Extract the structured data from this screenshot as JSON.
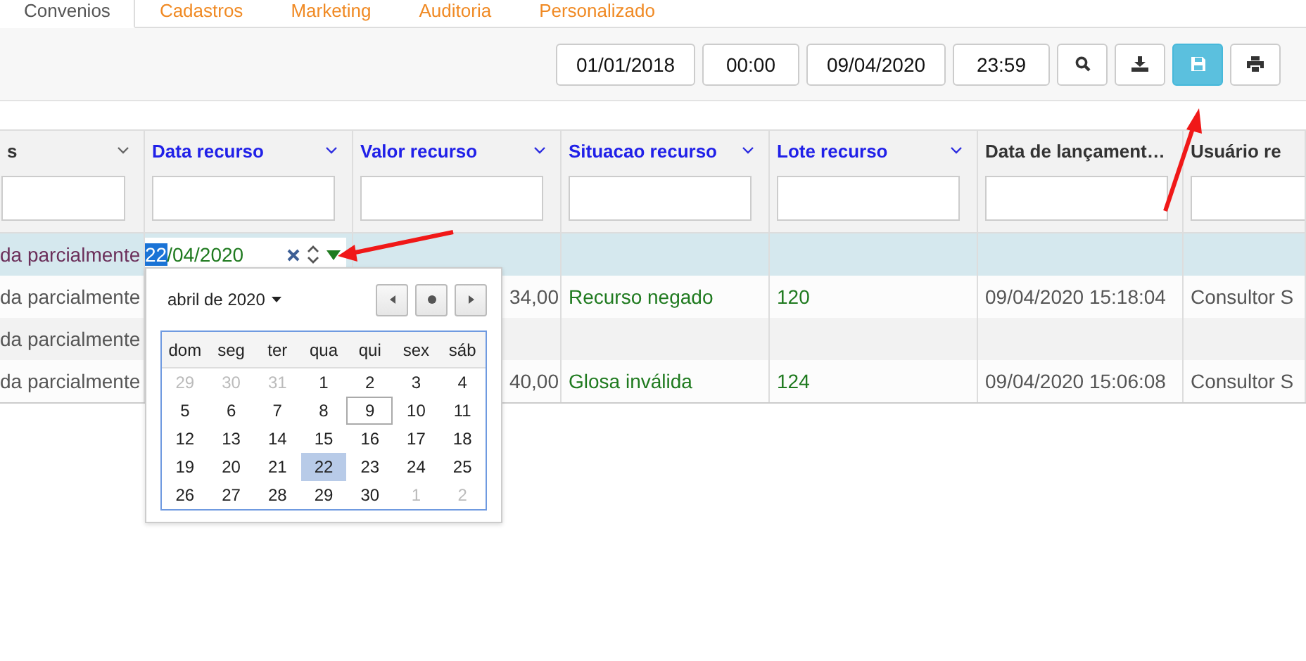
{
  "tabs": [
    {
      "label": "Convenios",
      "selected": true
    },
    {
      "label": "Cadastros",
      "selected": false
    },
    {
      "label": "Marketing",
      "selected": false
    },
    {
      "label": "Auditoria",
      "selected": false
    },
    {
      "label": "Personalizado",
      "selected": false
    }
  ],
  "toolbar": {
    "fields": [
      {
        "value": "01/01/2018",
        "kind": "date"
      },
      {
        "value": "00:00",
        "kind": "time"
      },
      {
        "value": "09/04/2020",
        "kind": "date"
      },
      {
        "value": "23:59",
        "kind": "time"
      }
    ],
    "buttons": [
      {
        "kind": "search",
        "highlighted": false
      },
      {
        "kind": "download",
        "highlighted": false
      },
      {
        "kind": "save",
        "highlighted": true
      },
      {
        "kind": "print",
        "highlighted": false
      }
    ]
  },
  "grid": {
    "columns": [
      {
        "label": "s",
        "highlighted": false,
        "menu": true,
        "kind": "text"
      },
      {
        "label": "Data recurso",
        "highlighted": true,
        "menu": true,
        "kind": "text"
      },
      {
        "label": "Valor recurso",
        "highlighted": true,
        "menu": true,
        "kind": "money"
      },
      {
        "label": "Situacao recurso",
        "highlighted": true,
        "menu": true,
        "kind": "result"
      },
      {
        "label": "Lote recurso",
        "highlighted": true,
        "menu": true,
        "kind": "result"
      },
      {
        "label": "Data de lançament…",
        "highlighted": false,
        "menu": false,
        "kind": "text"
      },
      {
        "label": "Usuário re",
        "highlighted": false,
        "menu": false,
        "kind": "text"
      }
    ],
    "rows": [
      {
        "selected": true,
        "editor": {
          "selected_part": "22",
          "rest": "/04/2020"
        },
        "cells": [
          "da parcialmente",
          null,
          null,
          null,
          null,
          null,
          null
        ]
      },
      {
        "selected": false,
        "cells": [
          "da parcialmente",
          null,
          "34,00",
          "Recurso negado",
          "120",
          "09/04/2020 15:18:04",
          "Consultor S"
        ]
      },
      {
        "selected": false,
        "cells": [
          "da parcialmente",
          null,
          null,
          null,
          null,
          null,
          null
        ]
      },
      {
        "selected": false,
        "cells": [
          "da parcialmente",
          null,
          "40,00",
          "Glosa inválida",
          "124",
          "09/04/2020 15:06:08",
          "Consultor S"
        ]
      }
    ]
  },
  "calendar": {
    "month": "abril de 2020",
    "weekdays": [
      "dom",
      "seg",
      "ter",
      "qua",
      "qui",
      "sex",
      "sáb"
    ],
    "days": [
      {
        "label": "29",
        "outside": true,
        "today": false,
        "selected": false
      },
      {
        "label": "30",
        "outside": true,
        "today": false,
        "selected": false
      },
      {
        "label": "31",
        "outside": true,
        "today": false,
        "selected": false
      },
      {
        "label": "1",
        "outside": false,
        "today": false,
        "selected": false
      },
      {
        "label": "2",
        "outside": false,
        "today": false,
        "selected": false
      },
      {
        "label": "3",
        "outside": false,
        "today": false,
        "selected": false
      },
      {
        "label": "4",
        "outside": false,
        "today": false,
        "selected": false
      },
      {
        "label": "5",
        "outside": false,
        "today": false,
        "selected": false
      },
      {
        "label": "6",
        "outside": false,
        "today": false,
        "selected": false
      },
      {
        "label": "7",
        "outside": false,
        "today": false,
        "selected": false
      },
      {
        "label": "8",
        "outside": false,
        "today": false,
        "selected": false
      },
      {
        "label": "9",
        "outside": false,
        "today": true,
        "selected": false
      },
      {
        "label": "10",
        "outside": false,
        "today": false,
        "selected": false
      },
      {
        "label": "11",
        "outside": false,
        "today": false,
        "selected": false
      },
      {
        "label": "12",
        "outside": false,
        "today": false,
        "selected": false
      },
      {
        "label": "13",
        "outside": false,
        "today": false,
        "selected": false
      },
      {
        "label": "14",
        "outside": false,
        "today": false,
        "selected": false
      },
      {
        "label": "15",
        "outside": false,
        "today": false,
        "selected": false
      },
      {
        "label": "16",
        "outside": false,
        "today": false,
        "selected": false
      },
      {
        "label": "17",
        "outside": false,
        "today": false,
        "selected": false
      },
      {
        "label": "18",
        "outside": false,
        "today": false,
        "selected": false
      },
      {
        "label": "19",
        "outside": false,
        "today": false,
        "selected": false
      },
      {
        "label": "20",
        "outside": false,
        "today": false,
        "selected": false
      },
      {
        "label": "21",
        "outside": false,
        "today": false,
        "selected": false
      },
      {
        "label": "22",
        "outside": false,
        "today": false,
        "selected": true
      },
      {
        "label": "23",
        "outside": false,
        "today": false,
        "selected": false
      },
      {
        "label": "24",
        "outside": false,
        "today": false,
        "selected": false
      },
      {
        "label": "25",
        "outside": false,
        "today": false,
        "selected": false
      },
      {
        "label": "26",
        "outside": false,
        "today": false,
        "selected": false
      },
      {
        "label": "27",
        "outside": false,
        "today": false,
        "selected": false
      },
      {
        "label": "28",
        "outside": false,
        "today": false,
        "selected": false
      },
      {
        "label": "29",
        "outside": false,
        "today": false,
        "selected": false
      },
      {
        "label": "30",
        "outside": false,
        "today": false,
        "selected": false
      },
      {
        "label": "1",
        "outside": true,
        "today": false,
        "selected": false
      },
      {
        "label": "2",
        "outside": true,
        "today": false,
        "selected": false
      }
    ]
  }
}
